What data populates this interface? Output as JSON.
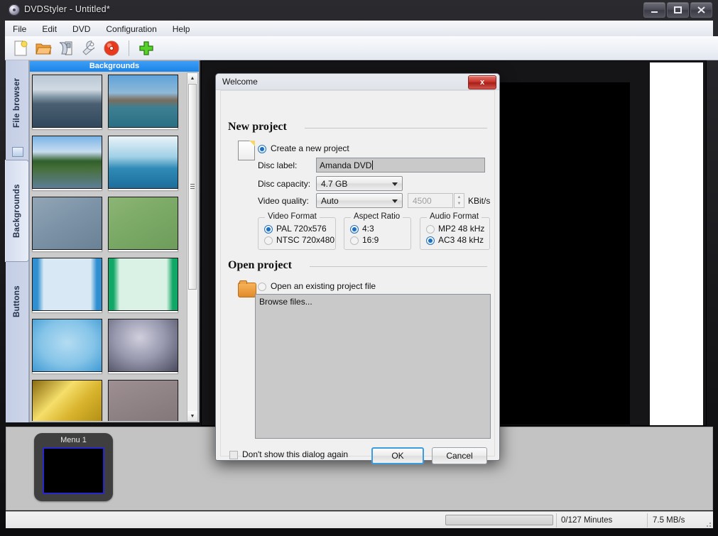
{
  "window": {
    "title": "DVDStyler - Untitled*",
    "app_icon": "disc-icon",
    "buttons": {
      "minimize": "minimize-icon",
      "maximize": "maximize-icon",
      "close": "close-icon"
    }
  },
  "menubar": {
    "items": [
      {
        "label": "File"
      },
      {
        "label": "Edit"
      },
      {
        "label": "DVD"
      },
      {
        "label": "Configuration"
      },
      {
        "label": "Help"
      }
    ]
  },
  "toolbar": {
    "items": [
      {
        "name": "new-project-icon",
        "title": "New"
      },
      {
        "name": "open-project-icon",
        "title": "Open"
      },
      {
        "name": "save-project-icon",
        "title": "Save"
      },
      {
        "name": "settings-wrench-icon",
        "title": "Settings"
      },
      {
        "name": "burn-disc-icon",
        "title": "Burn"
      },
      {
        "name": "add-icon",
        "title": "Add"
      }
    ]
  },
  "sidebar": {
    "tabs": [
      {
        "label": "File browser",
        "selected": false
      },
      {
        "label": "Backgrounds",
        "selected": true
      },
      {
        "label": "Buttons",
        "selected": false
      }
    ]
  },
  "backgrounds_panel": {
    "header": "Backgrounds",
    "thumbnails": [
      {
        "name": "sea-island-photo"
      },
      {
        "name": "shipwreck-photo"
      },
      {
        "name": "river-shore-photo"
      },
      {
        "name": "blue-gradient-hill"
      },
      {
        "name": "blurred-gray-blue"
      },
      {
        "name": "blurred-green"
      },
      {
        "name": "light-blue-bars"
      },
      {
        "name": "green-bars"
      },
      {
        "name": "blue-frame-gradient"
      },
      {
        "name": "gray-frame-gradient"
      },
      {
        "name": "gold-gradient"
      },
      {
        "name": "mauve-texture"
      }
    ]
  },
  "bottom_pane": {
    "menu_card": {
      "label": "Menu 1"
    }
  },
  "statusbar": {
    "progress_value": 0,
    "minutes": "0/127 Minutes",
    "speed": "7.5 MB/s"
  },
  "dialog": {
    "title": "Welcome",
    "close_label": "x",
    "new_project": {
      "heading": "New project",
      "radio_label": "Create a new project",
      "radio_selected": true,
      "fields": {
        "disc_label": {
          "label": "Disc label:",
          "value": "Amanda DVD"
        },
        "disc_capacity": {
          "label": "Disc capacity:",
          "value": "4.7 GB"
        },
        "video_quality": {
          "label": "Video quality:",
          "value": "Auto",
          "bitrate": "4500",
          "bitrate_unit": "KBit/s"
        }
      },
      "video_format": {
        "legend": "Video Format",
        "options": [
          {
            "label": "PAL 720x576",
            "selected": true
          },
          {
            "label": "NTSC 720x480",
            "selected": false
          }
        ]
      },
      "aspect_ratio": {
        "legend": "Aspect Ratio",
        "options": [
          {
            "label": "4:3",
            "selected": true
          },
          {
            "label": "16:9",
            "selected": false
          }
        ]
      },
      "audio_format": {
        "legend": "Audio Format",
        "options": [
          {
            "label": "MP2 48 kHz",
            "selected": false
          },
          {
            "label": "AC3 48 kHz",
            "selected": true
          }
        ]
      }
    },
    "open_project": {
      "heading": "Open project",
      "radio_label": "Open an existing project file",
      "radio_selected": false,
      "browse_placeholder": "Browse files..."
    },
    "footer": {
      "dont_show_label": "Don't show this dialog again",
      "dont_show_checked": false,
      "ok_label": "OK",
      "cancel_label": "Cancel"
    }
  },
  "colors": {
    "accent_blue": "#1c84e8",
    "dialog_bg": "#f0f0f0",
    "radio_blue": "#1d6fc0",
    "close_red": "#c9342b"
  }
}
